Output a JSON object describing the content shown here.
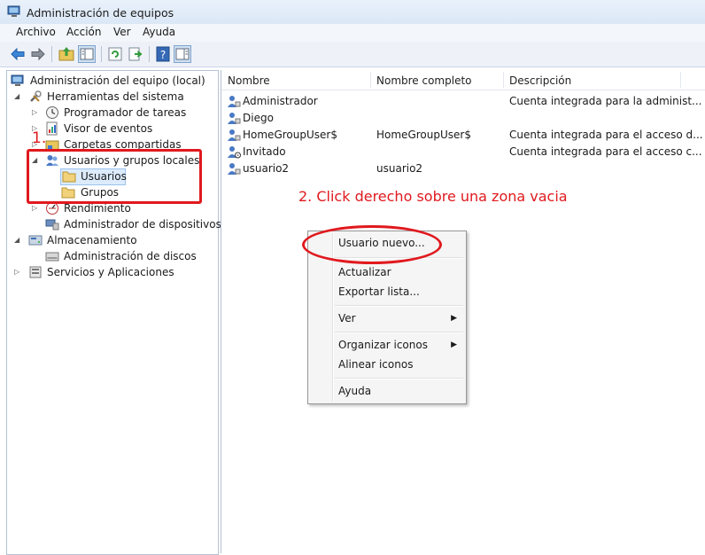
{
  "window": {
    "title": "Administración de equipos"
  },
  "menu": [
    "Archivo",
    "Acción",
    "Ver",
    "Ayuda"
  ],
  "toolbar": {
    "buttons": [
      "back-icon",
      "forward-icon",
      "up-folder-icon",
      "show-tree-icon",
      "refresh-icon",
      "export-icon",
      "help-icon",
      "show-action-pane-icon"
    ]
  },
  "tree": {
    "root": "Administración del equipo (local)",
    "system_tools": "Herramientas del sistema",
    "task_scheduler": "Programador de tareas",
    "event_viewer": "Visor de eventos",
    "shared_folders": "Carpetas compartidas",
    "local_users": "Usuarios y grupos locales",
    "users": "Usuarios",
    "groups": "Grupos",
    "performance": "Rendimiento",
    "device_manager": "Administrador de dispositivos",
    "storage": "Almacenamiento",
    "disk_management": "Administración de discos",
    "services": "Servicios y Aplicaciones"
  },
  "list": {
    "columns": [
      "Nombre",
      "Nombre completo",
      "Descripción"
    ],
    "rows": [
      {
        "name": "Administrador",
        "full_name": "",
        "description": "Cuenta integrada para la administ..."
      },
      {
        "name": "Diego",
        "full_name": "",
        "description": ""
      },
      {
        "name": "HomeGroupUser$",
        "full_name": "HomeGroupUser$",
        "description": "Cuenta integrada para el acceso d..."
      },
      {
        "name": "Invitado",
        "full_name": "",
        "description": "Cuenta integrada para el acceso c..."
      },
      {
        "name": "usuario2",
        "full_name": "usuario2",
        "description": ""
      }
    ]
  },
  "context_menu": {
    "new_user": "Usuario nuevo...",
    "refresh": "Actualizar",
    "export": "Exportar lista...",
    "view": "Ver",
    "arrange": "Organizar iconos",
    "align": "Alinear iconos",
    "help": "Ayuda"
  },
  "annotations": {
    "step1": "1.",
    "step2": "2. Click derecho sobre una zona vacia",
    "color": "#e0191e"
  }
}
